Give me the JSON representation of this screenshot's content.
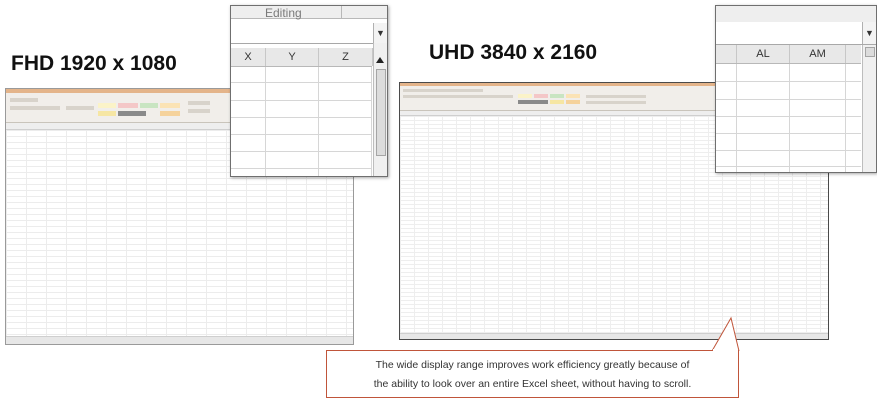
{
  "labels": {
    "fhd": "FHD 1920 x 1080",
    "uhd": "UHD 3840 x 2160"
  },
  "fhd_zoom": {
    "editing_label": "Editing",
    "columns": [
      "X",
      "Y",
      "Z"
    ]
  },
  "uhd_zoom": {
    "columns": [
      "AL",
      "AM"
    ]
  },
  "callout": {
    "line1": "The wide display range improves work efficiency greatly because of",
    "line2": "the ability to look over an entire Excel sheet, without having to scroll."
  },
  "colors": {
    "ribbon_accent": "#e4b48a",
    "callout_border": "#c0553a"
  }
}
